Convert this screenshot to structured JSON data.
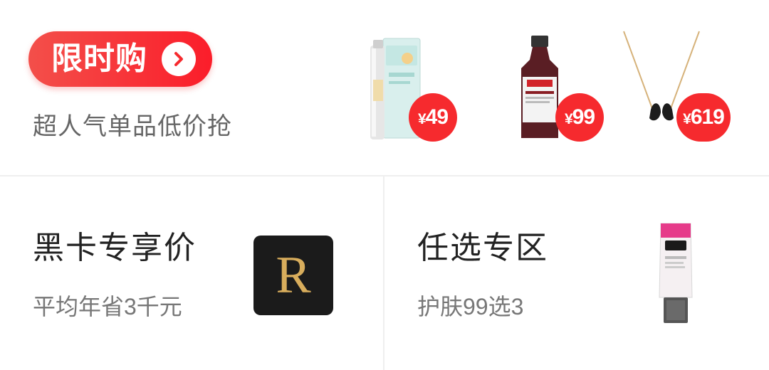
{
  "flash_sale": {
    "title": "限时购",
    "subtitle": "超人气单品低价抢",
    "arrow_icon": "chevron-right-icon",
    "accent_color": "#f62a2e",
    "products": [
      {
        "name": "sunscreen-spray",
        "currency": "¥",
        "price": "49"
      },
      {
        "name": "swisse-bottle",
        "currency": "¥",
        "price": "99"
      },
      {
        "name": "swan-necklace",
        "currency": "¥",
        "price": "619"
      }
    ]
  },
  "black_card": {
    "title": "黑卡专享价",
    "subtitle": "平均年省3千元",
    "logo_letter": "R"
  },
  "pick_zone": {
    "title": "任选专区",
    "subtitle": "护肤99选3"
  }
}
